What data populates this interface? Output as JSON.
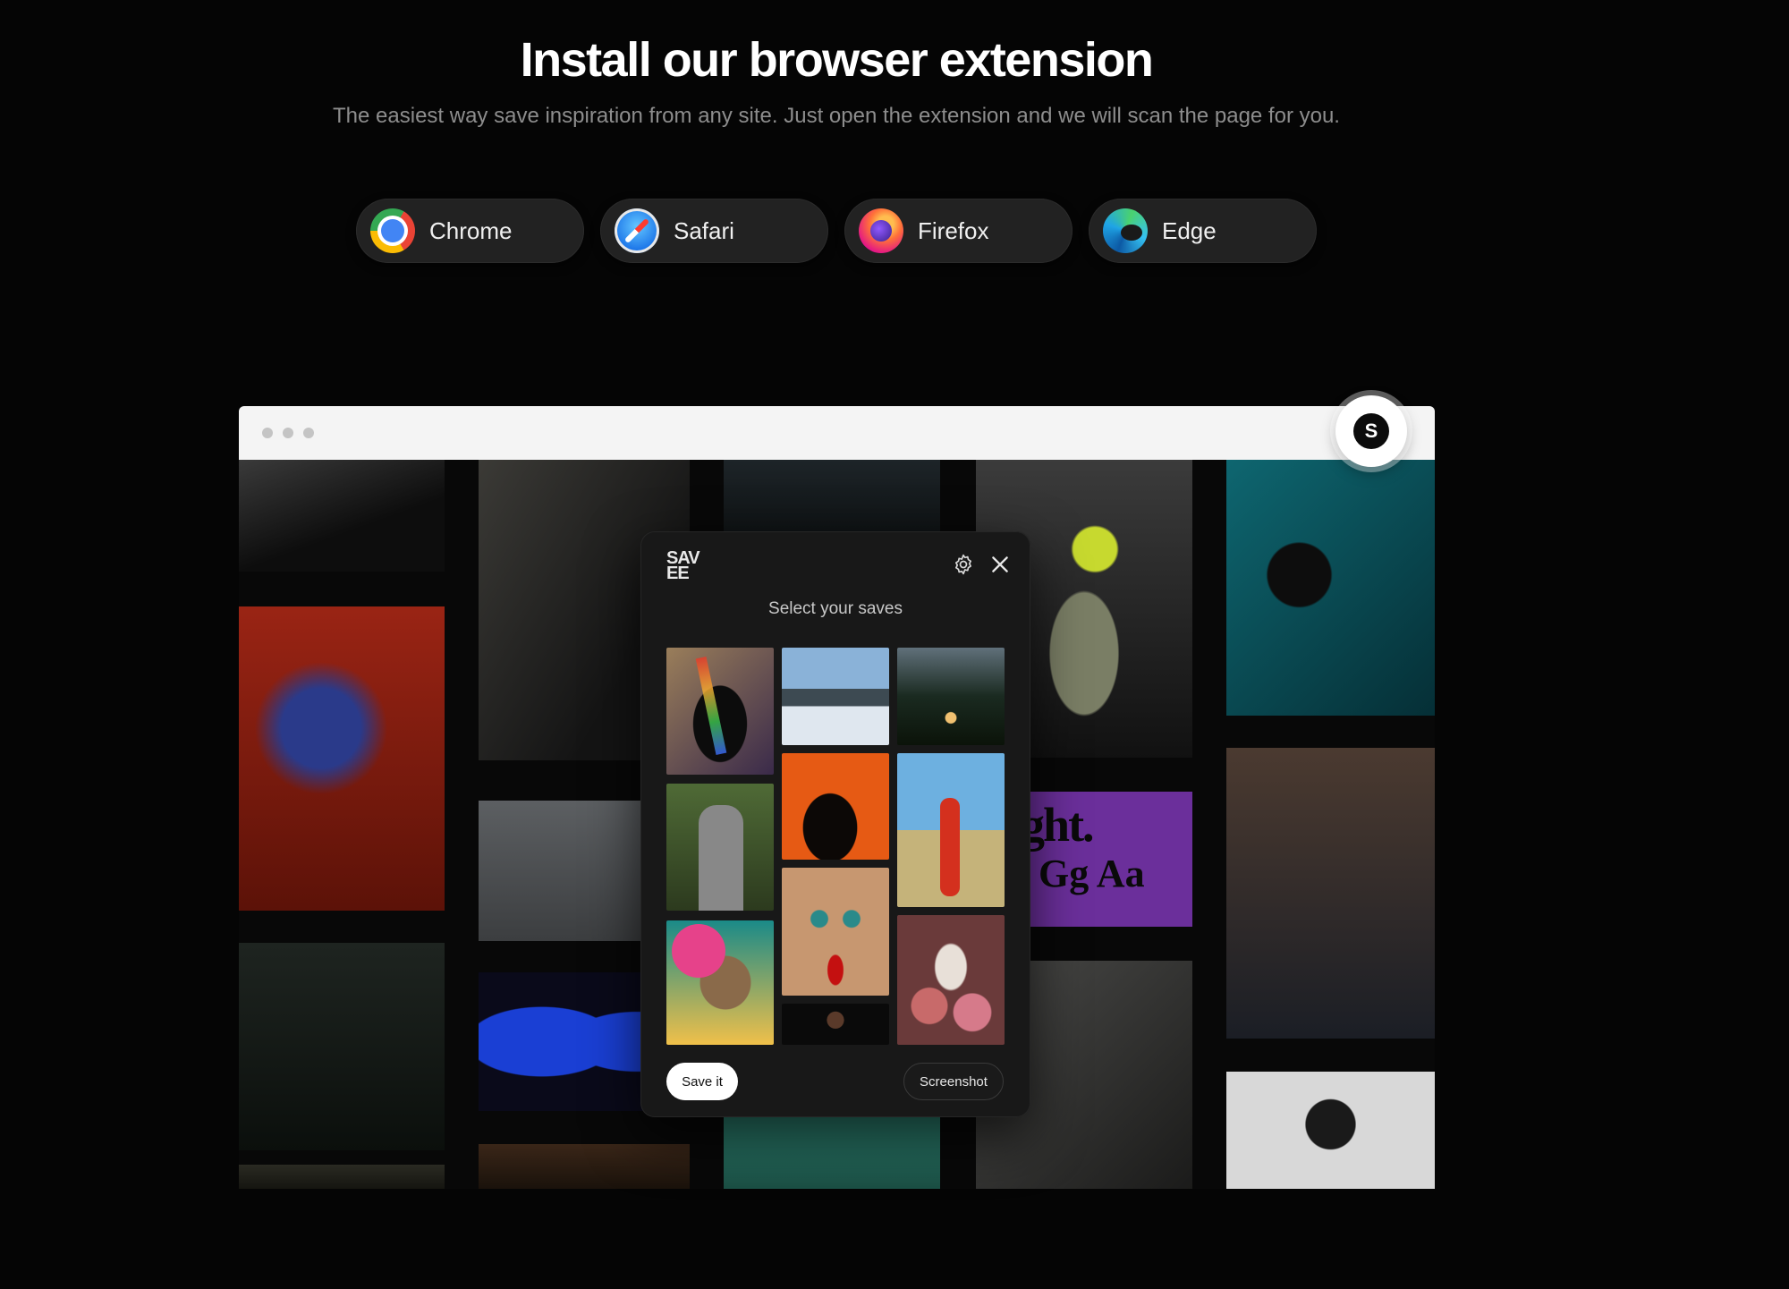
{
  "hero": {
    "title": "Install our browser extension",
    "subtitle": "The easiest way save inspiration from any site. Just open the extension and we will scan the page for you."
  },
  "browsers": [
    {
      "label": "Chrome",
      "icon": "chrome-icon"
    },
    {
      "label": "Safari",
      "icon": "safari-icon"
    },
    {
      "label": "Firefox",
      "icon": "firefox-icon"
    },
    {
      "label": "Edge",
      "icon": "edge-icon"
    }
  ],
  "extension_button": {
    "letter": "S"
  },
  "panel": {
    "brand": "SAVEE",
    "heading": "Select your saves",
    "save_label": "Save it",
    "screenshot_label": "Screenshot"
  },
  "mock_content": {
    "poster_title": "Voight.",
    "poster_glyphs": "Gg Aa"
  },
  "colors": {
    "background": "#050505",
    "button_bg": "#222222",
    "panel_bg": "#181818",
    "toolbar": "#f4f4f4"
  }
}
